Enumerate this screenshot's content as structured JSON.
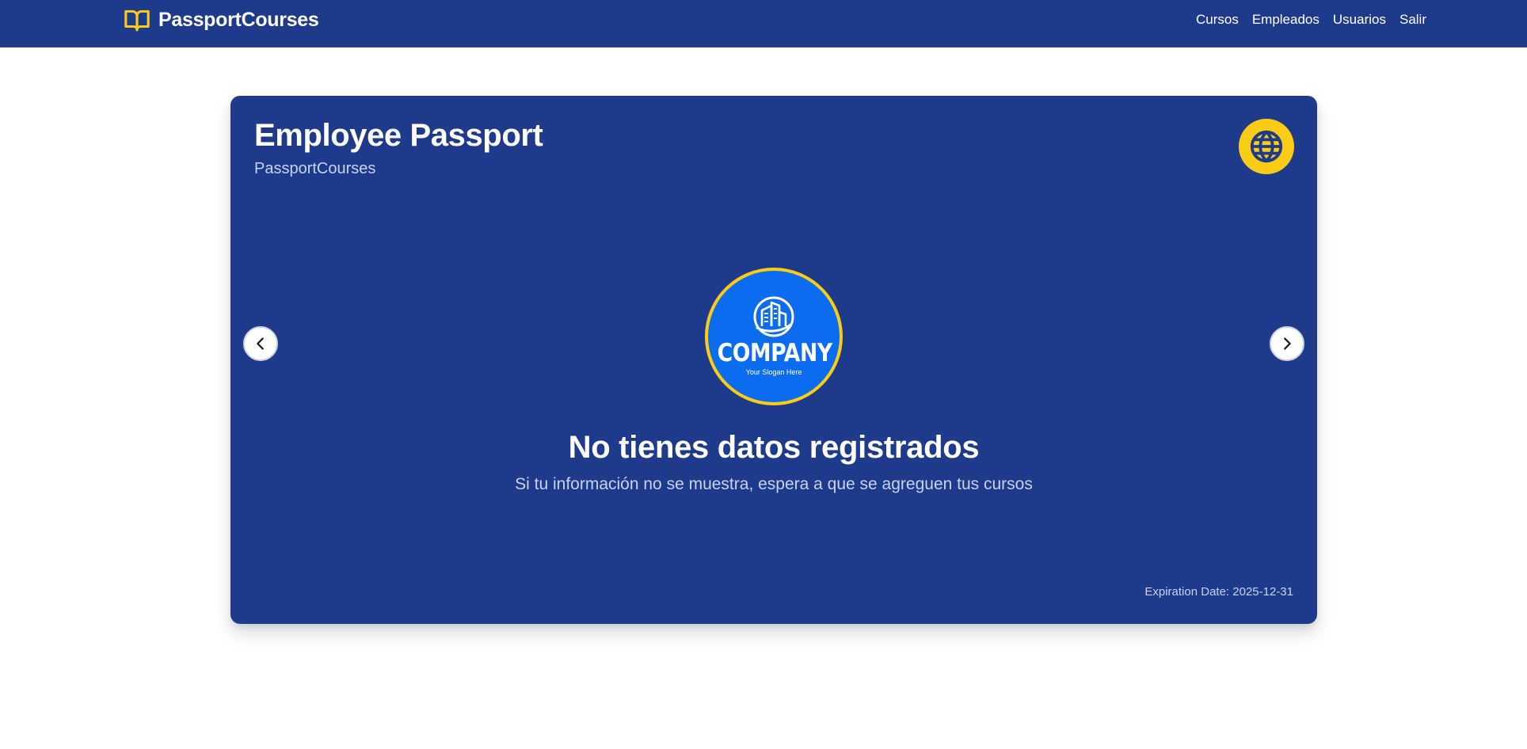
{
  "navbar": {
    "brand": {
      "name": "PassportCourses",
      "icon": "book-open-icon"
    },
    "links": [
      {
        "label": "Cursos"
      },
      {
        "label": "Empleados"
      },
      {
        "label": "Usuarios"
      },
      {
        "label": "Salir"
      }
    ]
  },
  "passport": {
    "title": "Employee Passport",
    "subtitle": "PassportCourses",
    "badge_icon": "globe-icon",
    "logo": {
      "name": "COMPANY",
      "slogan": "Your Slogan Here",
      "icon": "building-globe-icon"
    },
    "empty_state": {
      "title": "No tienes datos registrados",
      "message": "Si tu información no se muestra, espera a que se agreguen tus cursos"
    },
    "expiration": "Expiration Date: 2025-12-31",
    "carousel": {
      "prev_icon": "chevron-left-icon",
      "next_icon": "chevron-right-icon"
    }
  },
  "colors": {
    "primary": "#1e3a8a",
    "accent": "#facc15",
    "logo_blue": "#0b6cf0",
    "muted_text": "#c5d4f7",
    "white": "#ffffff"
  }
}
